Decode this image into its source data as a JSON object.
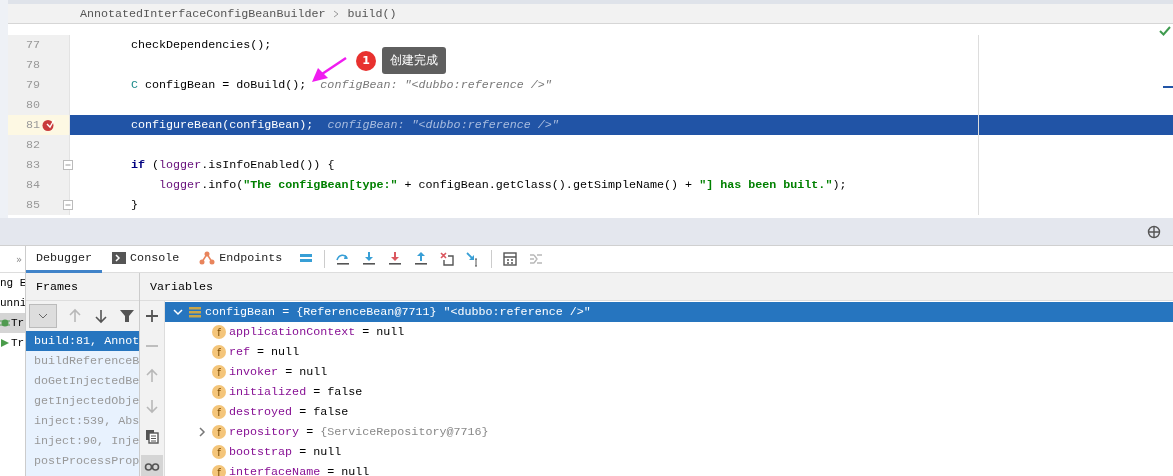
{
  "breadcrumb": [
    "AnnotatedInterfaceConfigBeanBuilder",
    "build()"
  ],
  "editor": {
    "lines": [
      {
        "number": "77",
        "current": false,
        "breakpoint": false,
        "tokens": [
          {
            "kind": "plain",
            "text": "checkDependencies();"
          }
        ]
      },
      {
        "number": "78",
        "current": false,
        "breakpoint": false
      },
      {
        "number": "79",
        "current": false,
        "breakpoint": false,
        "tokens": [
          {
            "kind": "type",
            "text": "C"
          },
          {
            "kind": "plain",
            "text": " configBean = doBuild();"
          },
          {
            "kind": "hint",
            "text": "configBean: \"<dubbo:reference />\""
          }
        ]
      },
      {
        "number": "80",
        "current": false,
        "breakpoint": false
      },
      {
        "number": "81",
        "current": true,
        "breakpoint": true,
        "tokens": [
          {
            "kind": "plain",
            "text": "configureBean(configBean);"
          },
          {
            "kind": "hint",
            "text": "configBean: \"<dubbo:reference />\""
          }
        ]
      },
      {
        "number": "82",
        "current": false,
        "breakpoint": false
      },
      {
        "number": "83",
        "current": false,
        "breakpoint": false,
        "foldable": true,
        "tokens": [
          {
            "kind": "keyword",
            "text": "if"
          },
          {
            "kind": "plain",
            "text": " ("
          },
          {
            "kind": "member",
            "text": "logger"
          },
          {
            "kind": "plain",
            "text": ".isInfoEnabled()) {"
          }
        ]
      },
      {
        "number": "84",
        "current": false,
        "breakpoint": false,
        "nested": true,
        "tokens": [
          {
            "kind": "member",
            "text": "logger"
          },
          {
            "kind": "plain",
            "text": ".info("
          },
          {
            "kind": "string",
            "text": "\"The configBean[type:\""
          },
          {
            "kind": "plain",
            "text": " + configBean.getClass().getSimpleName() + "
          },
          {
            "kind": "string",
            "text": "\"] has been built.\""
          },
          {
            "kind": "plain",
            "text": ");"
          }
        ]
      },
      {
        "number": "85",
        "current": false,
        "breakpoint": false,
        "foldable": true,
        "tokens": [
          {
            "kind": "plain",
            "text": "}"
          }
        ]
      }
    ],
    "annotation": {
      "badge": "1",
      "text": "创建完成"
    }
  },
  "run_panel": {
    "toggle": "»",
    "items": [
      {
        "text": "ng E",
        "kind": "text",
        "selected": false
      },
      {
        "text": "unni",
        "kind": "text",
        "selected": false
      },
      {
        "text": "Tr",
        "kind": "debug",
        "selected": true
      },
      {
        "text": "Tr",
        "kind": "run",
        "selected": false
      }
    ]
  },
  "debug_tabs": [
    {
      "label": "Debugger",
      "kind": "plain",
      "selected": true
    },
    {
      "label": "Console",
      "kind": "console",
      "selected": false
    },
    {
      "label": "Endpoints",
      "kind": "endpoints",
      "selected": false
    }
  ],
  "debug_toolbar": [
    {
      "kind": "frames-list",
      "disabled": false
    },
    {
      "kind": "step-over",
      "disabled": false
    },
    {
      "kind": "step-into",
      "disabled": false
    },
    {
      "kind": "force-step-into",
      "disabled": false
    },
    {
      "kind": "step-out",
      "disabled": false
    },
    {
      "kind": "drop-frame",
      "disabled": false
    },
    {
      "kind": "run-to-cursor",
      "disabled": false
    },
    {
      "kind": "evaluate",
      "disabled": false
    },
    {
      "kind": "trace",
      "disabled": true
    }
  ],
  "frames": {
    "title": "Frames",
    "toolbar": [
      {
        "kind": "dropdown",
        "disabled": false
      },
      {
        "kind": "up",
        "disabled": true
      },
      {
        "kind": "down",
        "disabled": false
      },
      {
        "kind": "filter",
        "disabled": false
      }
    ],
    "items": [
      {
        "text": "build:81, Annot",
        "selected": true
      },
      {
        "text": "buildReferenceB",
        "selected": false
      },
      {
        "text": "doGetInjectedBe",
        "selected": false
      },
      {
        "text": "getInjectedObje",
        "selected": false
      },
      {
        "text": "inject:539, Abs",
        "selected": false
      },
      {
        "text": "inject:90, Inje",
        "selected": false
      },
      {
        "text": "postProcessProp",
        "selected": false
      }
    ]
  },
  "variables": {
    "title": "Variables",
    "toolbar": [
      {
        "kind": "add",
        "disabled": false,
        "selected": false
      },
      {
        "kind": "remove",
        "disabled": true,
        "selected": false
      },
      {
        "kind": "up",
        "disabled": true,
        "selected": false
      },
      {
        "kind": "down",
        "disabled": true,
        "selected": false
      },
      {
        "kind": "copy",
        "disabled": false,
        "selected": false
      },
      {
        "kind": "watches",
        "disabled": false,
        "selected": true
      }
    ],
    "items": [
      {
        "kind": "local",
        "name": "configBean",
        "operator": "=",
        "value": "{ReferenceBean@7711} \"<dubbo:reference />\"",
        "dimmed": false,
        "expanded": true,
        "selected": true,
        "children": [
          {
            "kind": "field",
            "badge": "f",
            "name": "applicationContext",
            "operator": "=",
            "value": "null",
            "dimmed": false,
            "selected": false
          },
          {
            "kind": "field",
            "badge": "f",
            "name": "ref",
            "operator": "=",
            "value": "null",
            "dimmed": false,
            "selected": false
          },
          {
            "kind": "field",
            "badge": "f",
            "name": "invoker",
            "operator": "=",
            "value": "null",
            "dimmed": false,
            "selected": false
          },
          {
            "kind": "field",
            "badge": "f",
            "name": "initialized",
            "operator": "=",
            "value": "false",
            "dimmed": false,
            "selected": false
          },
          {
            "kind": "field",
            "badge": "f",
            "name": "destroyed",
            "operator": "=",
            "value": "false",
            "dimmed": false,
            "selected": false
          },
          {
            "kind": "field",
            "badge": "f",
            "name": "repository",
            "operator": "=",
            "value": "{ServiceRepository@7716}",
            "dimmed": true,
            "expanded": false,
            "selected": false
          },
          {
            "kind": "field",
            "badge": "f",
            "name": "bootstrap",
            "operator": "=",
            "value": "null",
            "dimmed": false,
            "selected": false
          },
          {
            "kind": "field",
            "badge": "f",
            "name": "interfaceName",
            "operator": "=",
            "value": "null",
            "dimmed": false,
            "selected": false
          }
        ]
      }
    ]
  }
}
